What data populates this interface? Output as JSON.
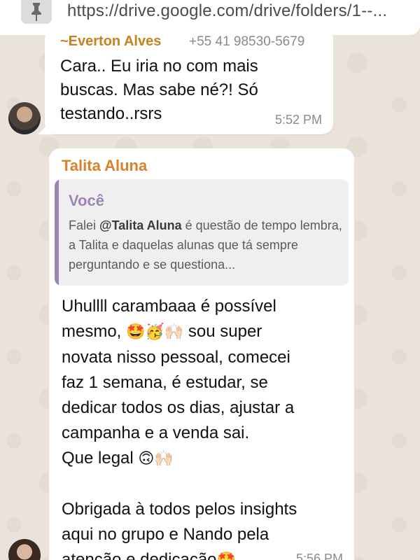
{
  "browser": {
    "url": "https://drive.google.com/drive/folders/1--..."
  },
  "messages": [
    {
      "sender": "~Everton Alves",
      "phone": "+55 41 98530-5679",
      "text": "Cara.. Eu iria no com mais\nbuscas. Mas sabe né?! Só\ntestando..rsrs",
      "time": "5:52 PM"
    },
    {
      "sender": "Talita Aluna",
      "quote": {
        "author": "Você",
        "text_before": "Falei ",
        "mention": "@Talita Aluna",
        "text_after": " é questão de tempo lembra, a Talita e daquelas alunas que tá sempre perguntando e se questiona..."
      },
      "body_lines": [
        "Uhullll carambaaa é possível",
        "mesmo,",
        "sou super",
        "novata nisso pessoal, comecei",
        "faz 1 semana, é estudar, se",
        "dedicar todos os dias, ajustar a",
        "campanha e a venda sai.",
        "Que legal",
        "Obrigada à todos pelos insights",
        "aqui no grupo e Nando pela",
        "atenção e dedicação"
      ],
      "emojis": {
        "line2": "🤩🥳🙌🏻",
        "line8": "🙃🙌🏻",
        "line11": "🤩"
      },
      "time": "5:56 PM"
    }
  ]
}
